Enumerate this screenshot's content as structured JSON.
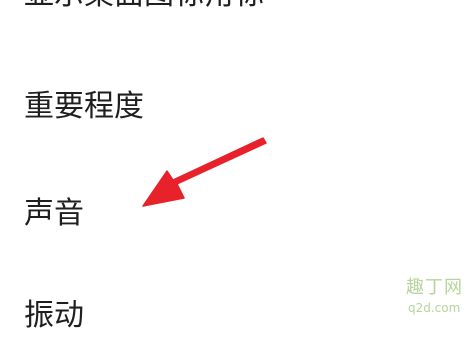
{
  "settings": {
    "items": [
      {
        "label": "显示桌面图标角标"
      },
      {
        "label": "重要程度"
      },
      {
        "label": "声音"
      },
      {
        "label": "振动"
      }
    ]
  },
  "annotation": {
    "arrow_color": "#e8222a",
    "target": "声音"
  },
  "watermark": {
    "title": "趣丁网",
    "url": "q2d.com",
    "color": "#b7d49c"
  }
}
